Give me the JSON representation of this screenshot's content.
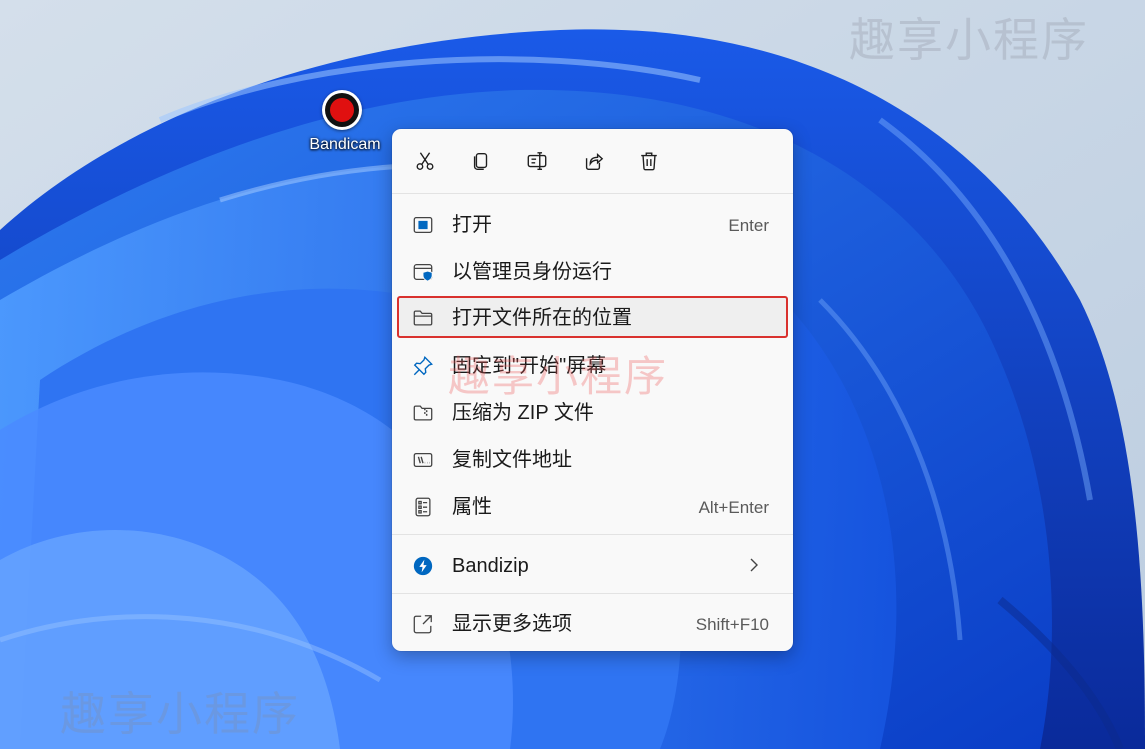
{
  "watermark": "趣享小程序",
  "desktop": {
    "icon_label": "Bandicam"
  },
  "context_menu": {
    "toolbar": [
      {
        "icon": "scissors-icon",
        "action": "cut"
      },
      {
        "icon": "copy-icon",
        "action": "copy"
      },
      {
        "icon": "rename-icon",
        "action": "rename"
      },
      {
        "icon": "share-icon",
        "action": "share"
      },
      {
        "icon": "trash-icon",
        "action": "delete"
      }
    ],
    "items": [
      {
        "label": "打开",
        "shortcut": "Enter",
        "icon": "open-window-icon"
      },
      {
        "label": "以管理员身份运行",
        "shortcut": "",
        "icon": "admin-shield-icon"
      },
      {
        "label": "打开文件所在的位置",
        "shortcut": "",
        "icon": "folder-icon",
        "highlighted": true
      },
      {
        "label": "固定到\"开始\"屏幕",
        "shortcut": "",
        "icon": "pin-icon"
      },
      {
        "label": "压缩为 ZIP 文件",
        "shortcut": "",
        "icon": "zip-folder-icon"
      },
      {
        "label": "复制文件地址",
        "shortcut": "",
        "icon": "copy-path-icon"
      },
      {
        "label": "属性",
        "shortcut": "Alt+Enter",
        "icon": "properties-icon"
      }
    ],
    "submenu": {
      "label": "Bandizip",
      "icon": "bandizip-icon"
    },
    "more": {
      "label": "显示更多选项",
      "shortcut": "Shift+F10",
      "icon": "more-options-icon"
    }
  },
  "colors": {
    "accent": "#0067c0",
    "highlight_border": "#d9312e",
    "menu_bg": "#f9f9f9"
  }
}
